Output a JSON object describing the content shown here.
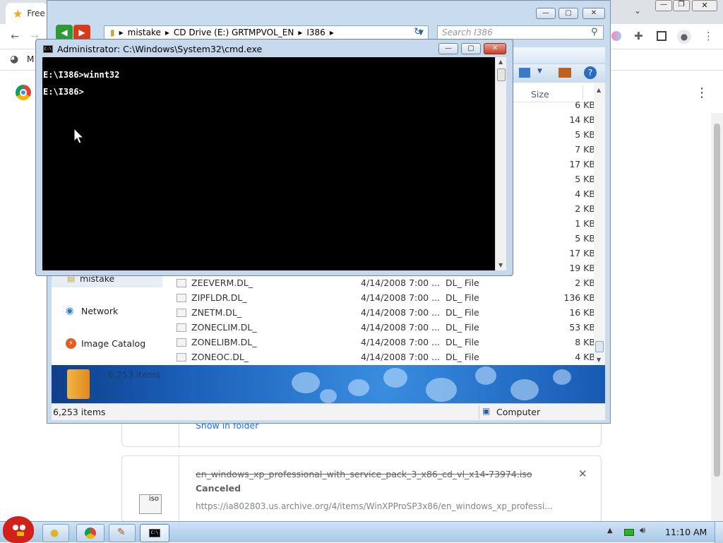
{
  "chrome": {
    "tab_label": "Free",
    "bookmark_label": "M",
    "downloads": [
      {
        "show_in_folder": "Show in folder"
      },
      {
        "filename": "en_windows_xp_professional_with_service_pack_3_x86_cd_vl_x14-73974.iso",
        "status": "Canceled",
        "url": "https://ia802803.us.archive.org/4/items/WinXPProSP3x86/en_windows_xp_professi...",
        "file_icon_text": "iso"
      }
    ]
  },
  "explorer": {
    "breadcrumb": [
      "mistake",
      "CD Drive (E:) GRTMPVOL_EN",
      "I386"
    ],
    "search_placeholder": "Search I386",
    "column_size": "Size",
    "sizes_above": [
      "6 KB",
      "14 KB",
      "5 KB",
      "7 KB",
      "17 KB",
      "5 KB",
      "4 KB",
      "2 KB",
      "1 KB",
      "5 KB",
      "17 KB",
      "19 KB"
    ],
    "files": [
      {
        "name": "ZEEVERM.DL_",
        "date": "4/14/2008 7:00 ...",
        "type": "DL_ File",
        "size": "2 KB"
      },
      {
        "name": "ZIPFLDR.DL_",
        "date": "4/14/2008 7:00 ...",
        "type": "DL_ File",
        "size": "136 KB"
      },
      {
        "name": "ZNETM.DL_",
        "date": "4/14/2008 7:00 ...",
        "type": "DL_ File",
        "size": "16 KB"
      },
      {
        "name": "ZONECLIM.DL_",
        "date": "4/14/2008 7:00 ...",
        "type": "DL_ File",
        "size": "53 KB"
      },
      {
        "name": "ZONELIBM.DL_",
        "date": "4/14/2008 7:00 ...",
        "type": "DL_ File",
        "size": "8 KB"
      },
      {
        "name": "ZONEOC.DL_",
        "date": "4/14/2008 7:00 ...",
        "type": "DL_ File",
        "size": "4 KB"
      }
    ],
    "nav": {
      "mistake": "mistake",
      "network": "Network",
      "image_catalog": "Image Catalog"
    },
    "details_count": "6,253 items",
    "status_count": "6,253 items",
    "status_location": "Computer"
  },
  "cmd": {
    "title": "Administrator: C:\\Windows\\System32\\cmd.exe",
    "line1": "E:\\I386>winnt32",
    "line2": "E:\\I386>"
  },
  "taskbar": {
    "clock": "11:10 AM"
  }
}
